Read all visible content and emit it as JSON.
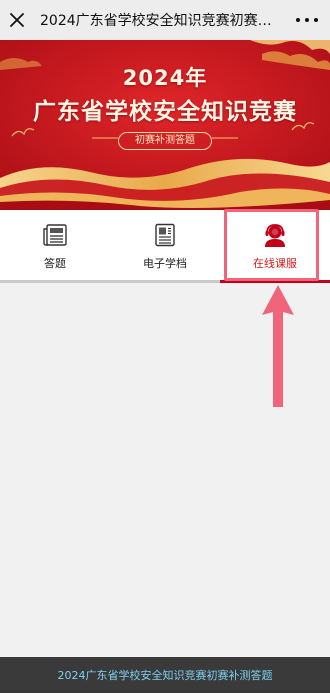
{
  "header": {
    "title": "2024广东省学校安全知识竞赛初赛…"
  },
  "banner": {
    "year_text": "2024年",
    "title_text": "广东省学校安全知识竞赛",
    "subtitle_text": "初赛补测答题",
    "colors": {
      "background": "#c8161d",
      "gold": "#f4c26b",
      "text": "#fff7e6"
    }
  },
  "menu": {
    "items": [
      {
        "label": "答题",
        "icon": "newspaper-icon"
      },
      {
        "label": "电子学档",
        "icon": "document-icon"
      },
      {
        "label": "在线课服",
        "icon": "customer-service-icon"
      }
    ],
    "active_index": 2,
    "accent_color": "#c0001a"
  },
  "annotation": {
    "highlight_color": "#f0657a",
    "arrow_color": "#f0657a"
  },
  "footer": {
    "text": "2024广东省学校安全知识竞赛初赛补测答题"
  }
}
